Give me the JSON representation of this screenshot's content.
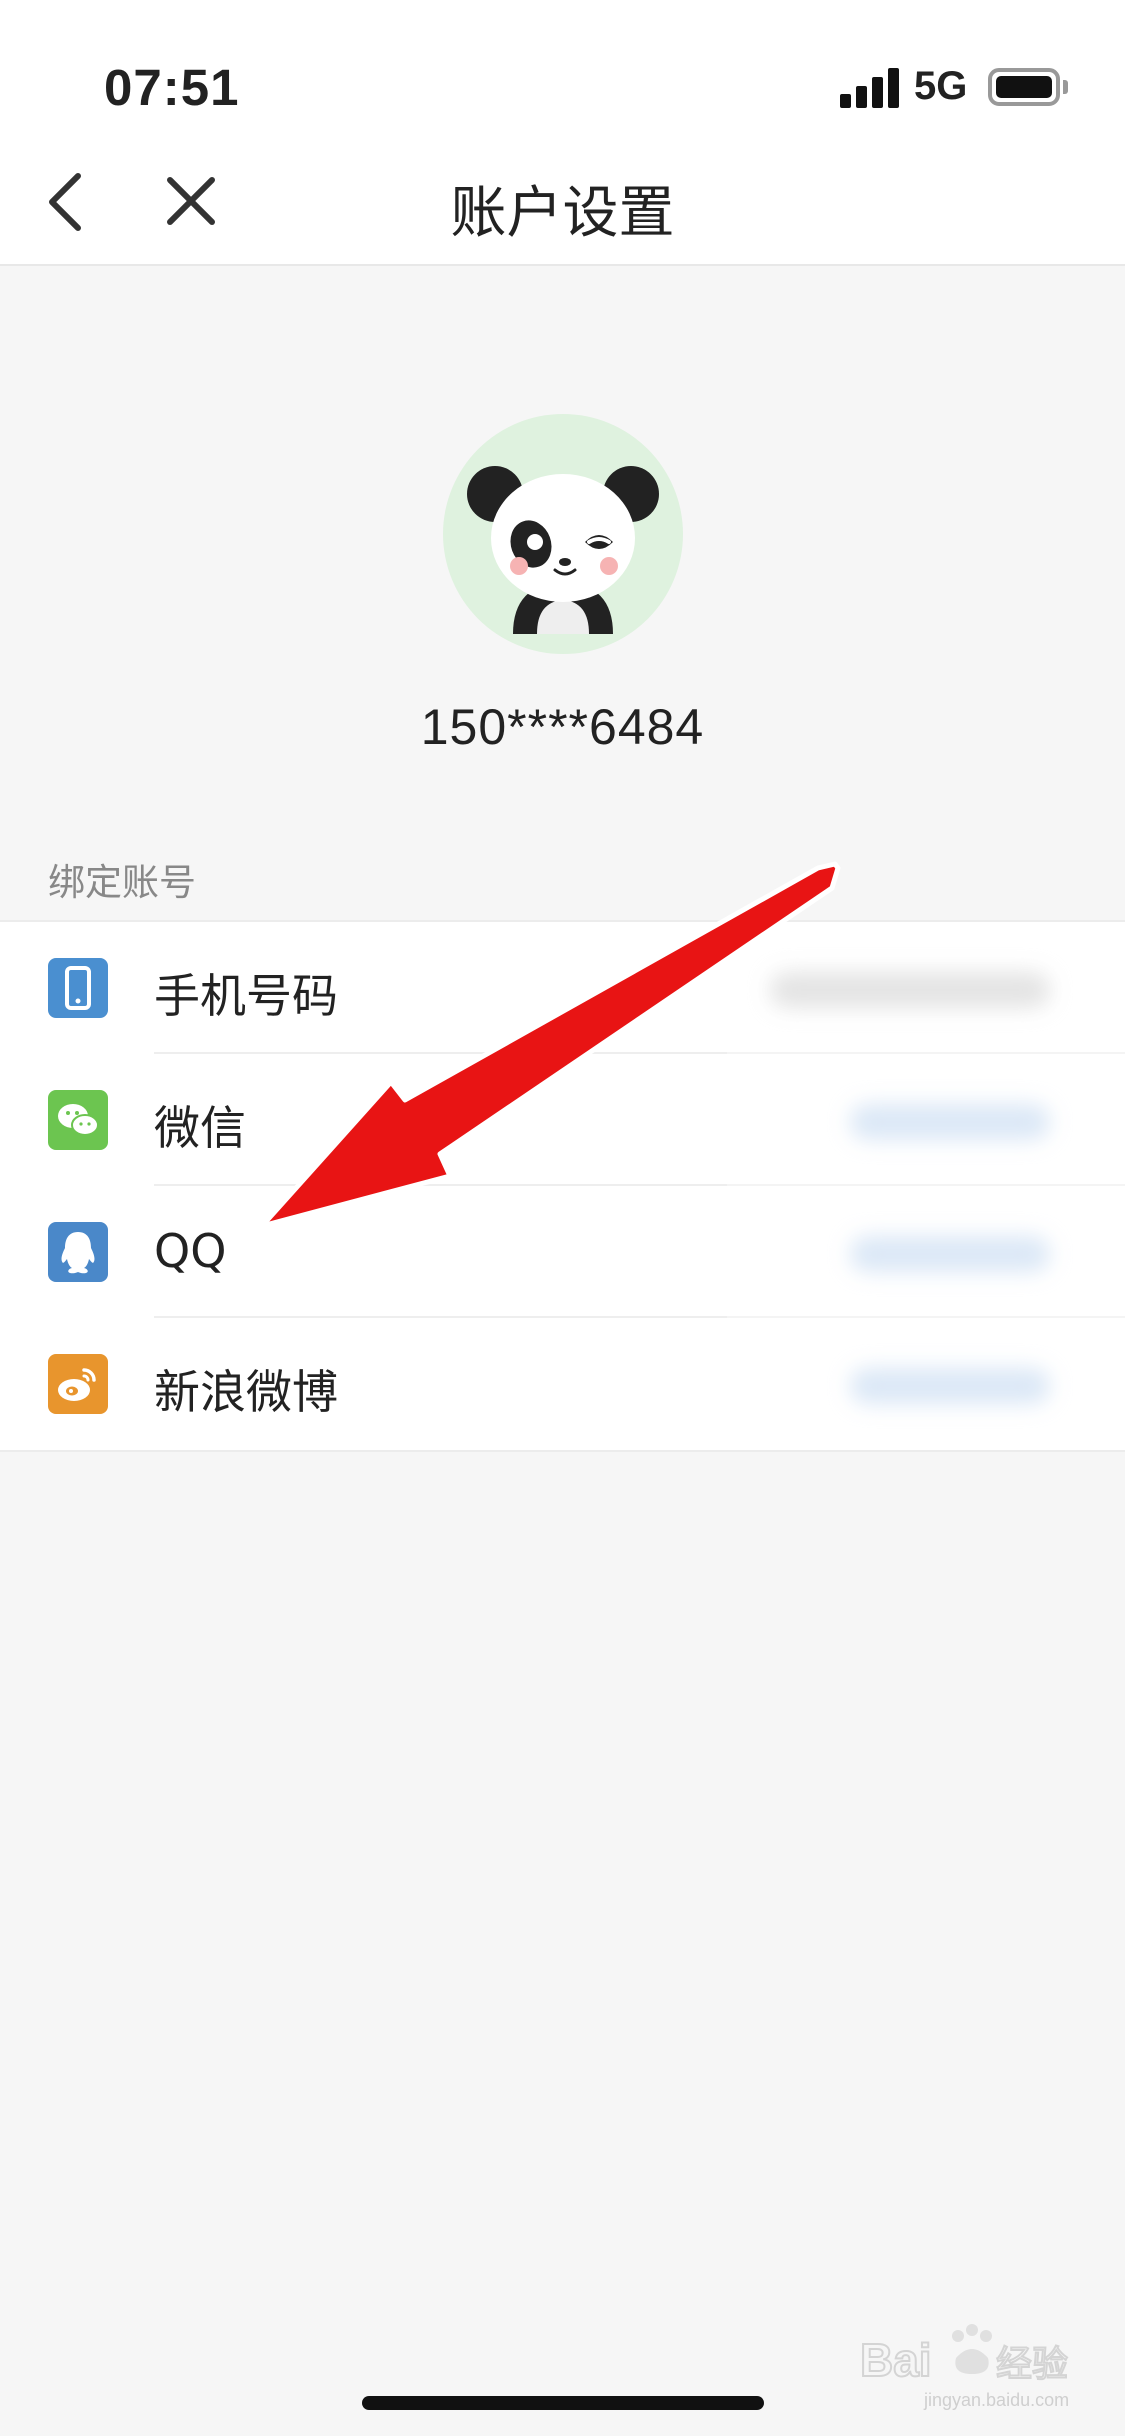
{
  "status_bar": {
    "time": "07:51",
    "network": "5G",
    "icons": [
      "signal-bars-icon",
      "battery-icon"
    ]
  },
  "nav": {
    "title": "账户设置",
    "back_icon": "chevron-left-icon",
    "close_icon": "close-icon"
  },
  "profile": {
    "avatar_icon": "panda-avatar-icon",
    "phone_masked": "150****6484"
  },
  "bound_accounts": {
    "section_label": "绑定账号",
    "items": [
      {
        "label": "手机号码",
        "icon": "phone-icon",
        "icon_color": "#4a8fd0"
      },
      {
        "label": "微信",
        "icon": "wechat-icon",
        "icon_color": "#6cc550"
      },
      {
        "label": "QQ",
        "icon": "qq-icon",
        "icon_color": "#4a88c9"
      },
      {
        "label": "新浪微博",
        "icon": "weibo-icon",
        "icon_color": "#e8952d"
      }
    ]
  },
  "colors": {
    "annotation_arrow": "#e81414",
    "background": "#f6f6f6",
    "avatar_bg": "#dff2df",
    "blurred_value": "#c9dcf2"
  },
  "watermark": {
    "brand": "Baidu经验",
    "url": "jingyan.baidu.com"
  }
}
